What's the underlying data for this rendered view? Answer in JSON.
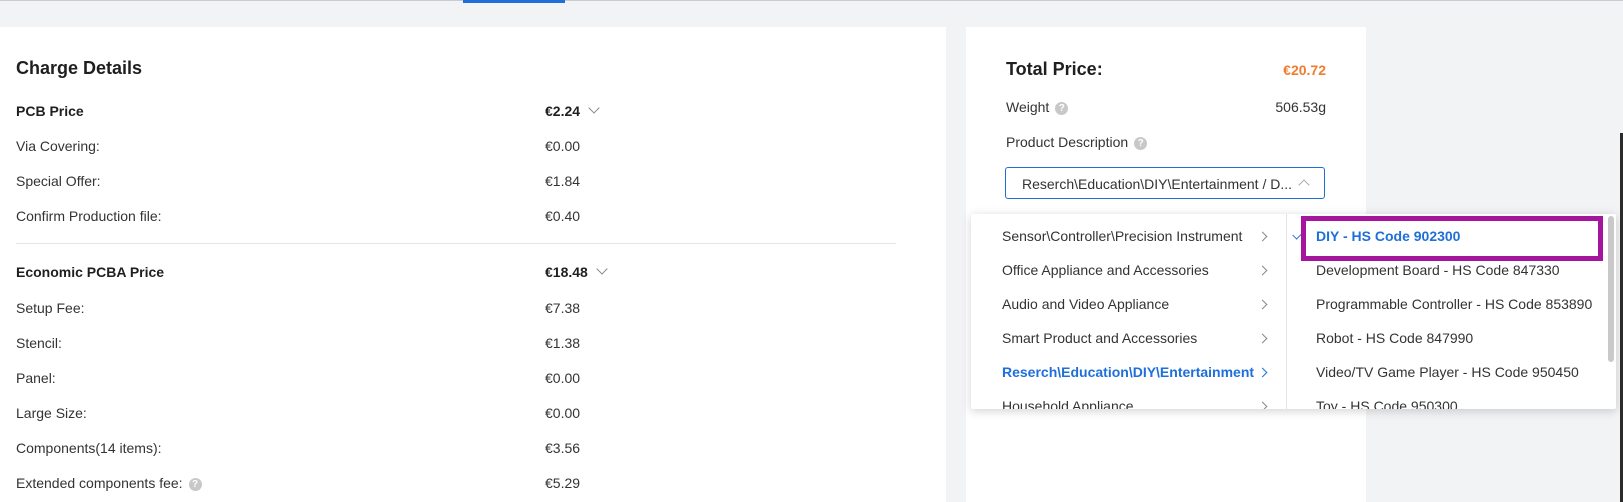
{
  "charge_details": {
    "title": "Charge Details",
    "pcb": {
      "label": "PCB Price",
      "value": "€2.24",
      "rows": [
        {
          "label": "Via Covering:",
          "value": "€0.00"
        },
        {
          "label": "Special Offer:",
          "value": "€1.84"
        },
        {
          "label": "Confirm Production file:",
          "value": "€0.40"
        }
      ]
    },
    "pcba": {
      "label": "Economic PCBA Price",
      "value": "€18.48",
      "rows": [
        {
          "label": "Setup Fee:",
          "value": "€7.38"
        },
        {
          "label": "Stencil:",
          "value": "€1.38"
        },
        {
          "label": "Panel:",
          "value": "€0.00"
        },
        {
          "label": "Large Size:",
          "value": "€0.00"
        },
        {
          "label": "Components(14 items):",
          "value": "€3.56"
        },
        {
          "label": "Extended components fee:",
          "value": "€5.29"
        }
      ]
    }
  },
  "summary": {
    "total_label": "Total Price:",
    "total_value": "€20.72",
    "weight_label": "Weight",
    "weight_value": "506.53g",
    "product_description_label": "Product Description",
    "help_glyph": "?",
    "select_value": "Reserch\\Education\\DIY\\Entertainment / D..."
  },
  "dropdown": {
    "categories": [
      {
        "label": "Sensor\\Controller\\Precision Instrument"
      },
      {
        "label": "Office Appliance and Accessories"
      },
      {
        "label": "Audio and Video Appliance"
      },
      {
        "label": "Smart Product and Accessories"
      },
      {
        "label": "Reserch\\Education\\DIY\\Entertainment"
      },
      {
        "label": "Household Appliance"
      }
    ],
    "subitems": [
      {
        "label": "DIY - HS Code 902300"
      },
      {
        "label": "Development Board - HS Code 847330"
      },
      {
        "label": "Programmable Controller - HS Code 853890"
      },
      {
        "label": "Robot - HS Code 847990"
      },
      {
        "label": "Video/TV Game Player - HS Code 950450"
      },
      {
        "label": "Toy - HS Code 950300"
      }
    ]
  },
  "colors": {
    "accent": "#1e6fd9",
    "total_price": "#f07c2e",
    "highlight": "#a4169b"
  }
}
